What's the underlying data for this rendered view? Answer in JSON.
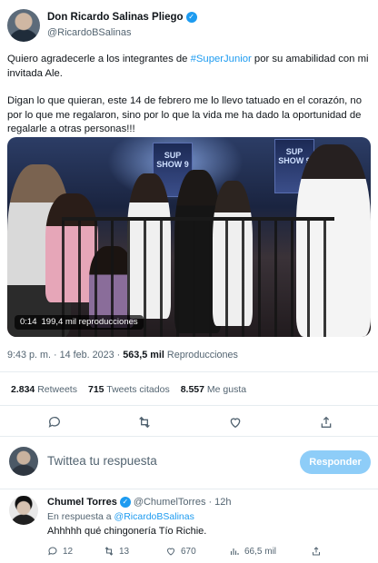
{
  "author": {
    "name": "Don Ricardo Salinas Pliego",
    "handle": "@RicardoBSalinas",
    "verified_mark": "✓"
  },
  "tweet": {
    "line1_before": "Quiero agradecerle a los integrantes de ",
    "hashtag": "#SuperJunior",
    "line1_after": " por su amabilidad con mi invitada Ale.",
    "paragraph2": "Digan lo que quieran, este 14 de febrero me lo llevo tatuado en el corazón, no por lo que me regalaron, sino por lo que la vida me ha dado la oportunidad de regalarle a otras personas!!!"
  },
  "media": {
    "screen_text_left": "SUP SHOW 9",
    "screen_text_right": "SUP SHOW 9",
    "duration": "0:14",
    "views": "199,4 mil reproducciones"
  },
  "meta": {
    "time": "9:43 p. m.",
    "separator": "·",
    "date": "14 feb. 2023",
    "views_count": "563,5 mil",
    "views_label": "Reproducciones"
  },
  "stats": {
    "retweets_count": "2.834",
    "retweets_label": "Retweets",
    "quotes_count": "715",
    "quotes_label": "Tweets citados",
    "likes_count": "8.557",
    "likes_label": "Me gusta"
  },
  "actions": {
    "icons": [
      "reply-icon",
      "retweet-icon",
      "like-icon",
      "share-icon"
    ]
  },
  "reply_box": {
    "placeholder": "Twittea tu respuesta",
    "button_label": "Responder"
  },
  "reply": {
    "name": "Chumel Torres",
    "verified_mark": "✓",
    "handle": "@ChumelTorres",
    "dot": "·",
    "time": "12h",
    "in_reply_label": "En respuesta a ",
    "in_reply_mention": "@RicardoBSalinas",
    "text": "Ahhhhh qué chingonería Tío Richie.",
    "replies": "12",
    "retweets": "13",
    "likes": "670",
    "views": "66,5 mil"
  },
  "colors": {
    "accent": "#1d9bf0",
    "text": "#0f1419",
    "muted": "#536471",
    "button_disabled": "#8ecdf8"
  }
}
